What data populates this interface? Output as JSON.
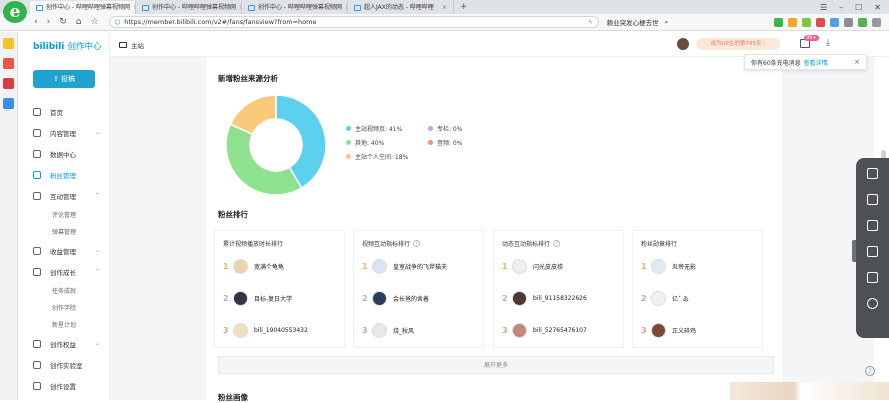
{
  "browser": {
    "tabs": [
      {
        "label": "创作中心 - 哔哩哔哩弹幕视频网"
      },
      {
        "label": "创作中心 - 哔哩哔哩弹幕视频网"
      },
      {
        "label": "创作中心 - 哔哩哔哩弹幕视频网"
      },
      {
        "label": "超人JAX的动态 - 哔哩哔哩"
      }
    ],
    "new_tab": "+",
    "url": "https://member.bilibili.com/v2#/fans/fansview?from=home",
    "search_text": "赖业突发心梗去世"
  },
  "brand": {
    "logo": "bilibili",
    "title": "创作中心"
  },
  "upload_button": "投稿",
  "nav": {
    "items": [
      {
        "label": "首页"
      },
      {
        "label": "内容管理"
      },
      {
        "label": "数据中心"
      },
      {
        "label": "粉丝管理"
      },
      {
        "label": "互动管理"
      }
    ],
    "interact_sub": [
      "评论管理",
      "弹幕管理"
    ],
    "income": "收益管理",
    "growth": "创作成长",
    "growth_sub": [
      "任务成就",
      "创作学院",
      "新星计划"
    ],
    "rights": "创作权益",
    "lab": "创作实验室",
    "settings": "创作设置"
  },
  "header": {
    "home": "主站",
    "up_badge": "成为UP主的第745天 ›",
    "msg_count": "99+"
  },
  "notice": {
    "text": "你有60条充电消息",
    "link": "查看详情",
    "close": "×"
  },
  "source_title": "新增粉丝来源分析",
  "chart_data": {
    "type": "pie",
    "title": "新增粉丝来源分析",
    "slices": [
      {
        "label": "主站视频页",
        "value": 41,
        "display": "主站视频页: 41%",
        "color": "#5bd1ee"
      },
      {
        "label": "其他",
        "value": 40,
        "display": "其他: 40%",
        "color": "#8ee28f"
      },
      {
        "label": "主站个人空间",
        "value": 18,
        "display": "主站个人空间: 18%",
        "color": "#fbc97a"
      },
      {
        "label": "专栏",
        "value": 0,
        "display": "专栏: 0%",
        "color": "#c99ff0"
      },
      {
        "label": "音频",
        "value": 0,
        "display": "音频: 0%",
        "color": "#f48f7a"
      }
    ]
  },
  "rank_title": "粉丝排行",
  "rank_columns": [
    {
      "title": "累计视频播放时长排行",
      "has_help": false,
      "rows": [
        {
          "rank": "1",
          "name": "宽满个龟龟"
        },
        {
          "rank": "2",
          "name": "目标-复日大学"
        },
        {
          "rank": "3",
          "name": "bili_19040553432"
        }
      ]
    },
    {
      "title": "视频互动指标排行",
      "has_help": true,
      "rows": [
        {
          "rank": "1",
          "name": "皇室战争的飞斧猫夫"
        },
        {
          "rank": "2",
          "name": "会长爸的舍着"
        },
        {
          "rank": "3",
          "name": "烧_秋风"
        }
      ]
    },
    {
      "title": "动态互动指标排行",
      "has_help": true,
      "rows": [
        {
          "rank": "1",
          "name": "闪光皮皮捞"
        },
        {
          "rank": "2",
          "name": "bili_91158322626"
        },
        {
          "rank": "3",
          "name": "bili_52765476107"
        }
      ]
    },
    {
      "title": "粉丝勋章排行",
      "has_help": false,
      "rows": [
        {
          "rank": "1",
          "name": "炎帝无影"
        },
        {
          "rank": "2",
          "name": "亿ˇ ゐ"
        },
        {
          "rank": "3",
          "name": "正义碎鸡"
        }
      ]
    }
  ],
  "expand_more": "展开更多",
  "portrait_title": "粉丝画像",
  "help": "?"
}
